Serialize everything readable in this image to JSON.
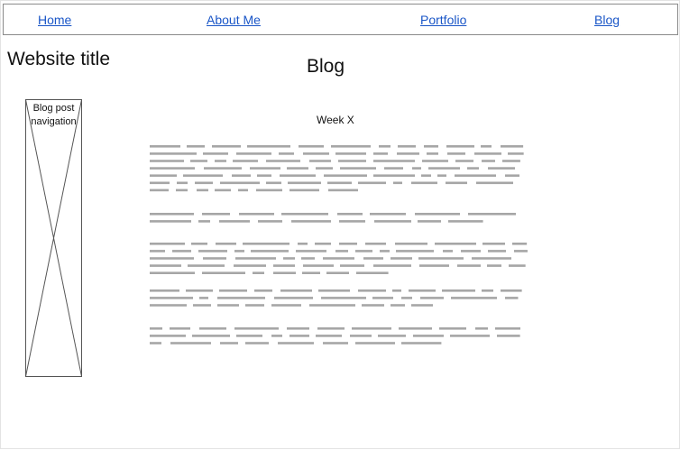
{
  "nav": {
    "items": [
      {
        "label": "Home"
      },
      {
        "label": "About Me"
      },
      {
        "label": "Portfolio"
      },
      {
        "label": "Blog"
      }
    ],
    "link_color": "#1a56c7"
  },
  "site_title": "Website title",
  "page_heading": "Blog",
  "sidebar": {
    "placeholder_label": "Blog post navigation"
  },
  "post": {
    "title": "Week X",
    "placeholder_text_color": "#a6a6a6"
  }
}
